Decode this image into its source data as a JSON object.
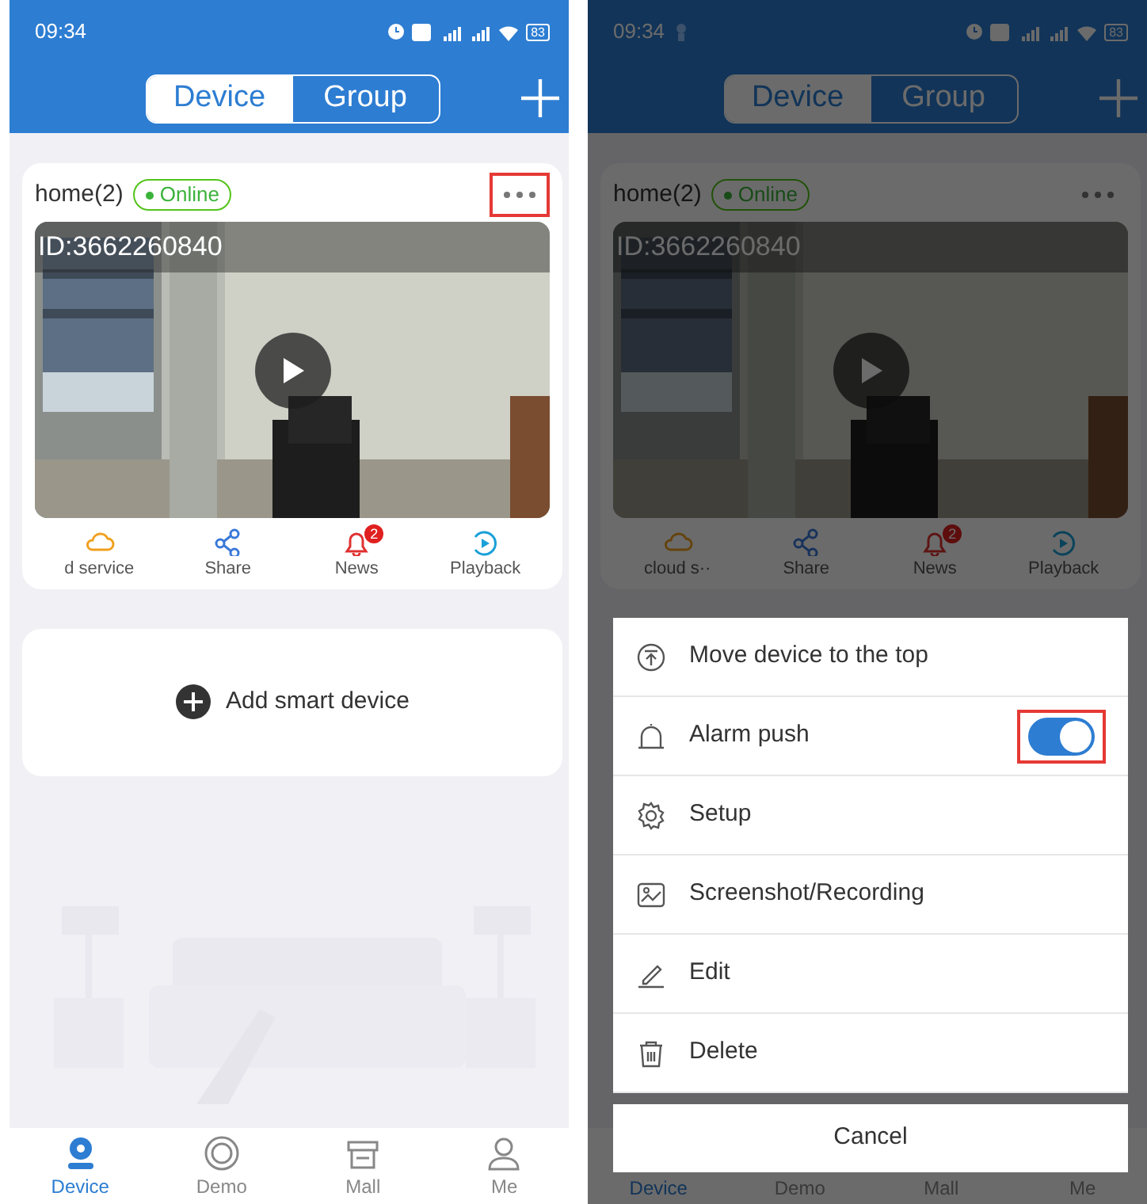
{
  "screens": [
    {
      "status_bar": {
        "time": "09:34",
        "battery": "83"
      },
      "segments": [
        {
          "label": "Device",
          "selected": true
        },
        {
          "label": "Group",
          "selected": false
        }
      ],
      "device_card": {
        "name": "home(2)",
        "status": "Online",
        "more_highlighted": true,
        "camera_id": "ID:3662260840",
        "actions": [
          {
            "label": "d service",
            "kind": "cloud"
          },
          {
            "label": "Share",
            "kind": "share"
          },
          {
            "label": "News",
            "kind": "news",
            "badge": "2"
          },
          {
            "label": "Playback",
            "kind": "playback"
          }
        ]
      },
      "add_device": "Add smart device",
      "tab_bar": [
        {
          "label": "Device",
          "kind": "device",
          "selected": true
        },
        {
          "label": "Demo",
          "kind": "demo",
          "selected": false
        },
        {
          "label": "Mall",
          "kind": "mall",
          "selected": false
        },
        {
          "label": "Me",
          "kind": "me",
          "selected": false
        }
      ]
    },
    {
      "status_bar": {
        "time": "09:34",
        "battery": "83",
        "notification_icon": true
      },
      "segments": [
        {
          "label": "Device",
          "selected": true
        },
        {
          "label": "Group",
          "selected": false
        }
      ],
      "device_card": {
        "name": "home(2)",
        "status": "Online",
        "more_highlighted": false,
        "camera_id": "ID:3662260840",
        "actions": [
          {
            "label": "cloud s··",
            "kind": "cloud"
          },
          {
            "label": "Share",
            "kind": "share"
          },
          {
            "label": "News",
            "kind": "news",
            "badge": "2"
          },
          {
            "label": "Playback",
            "kind": "playback"
          }
        ]
      },
      "tab_bar": [
        {
          "label": "Device",
          "selected": true
        },
        {
          "label": "Demo",
          "selected": false
        },
        {
          "label": "Mall",
          "selected": false
        },
        {
          "label": "Me",
          "selected": false
        }
      ],
      "menu": {
        "items": [
          {
            "kind": "top",
            "label": "Move device to the top"
          },
          {
            "kind": "alarm",
            "label": "Alarm push",
            "on": true,
            "highlighted": true
          },
          {
            "kind": "setup",
            "label": "Setup"
          },
          {
            "kind": "screenshot",
            "label": "Screenshot/Recording"
          },
          {
            "kind": "edit",
            "label": "Edit"
          },
          {
            "kind": "delete",
            "label": "Delete"
          }
        ],
        "cancel": "Cancel"
      }
    }
  ]
}
